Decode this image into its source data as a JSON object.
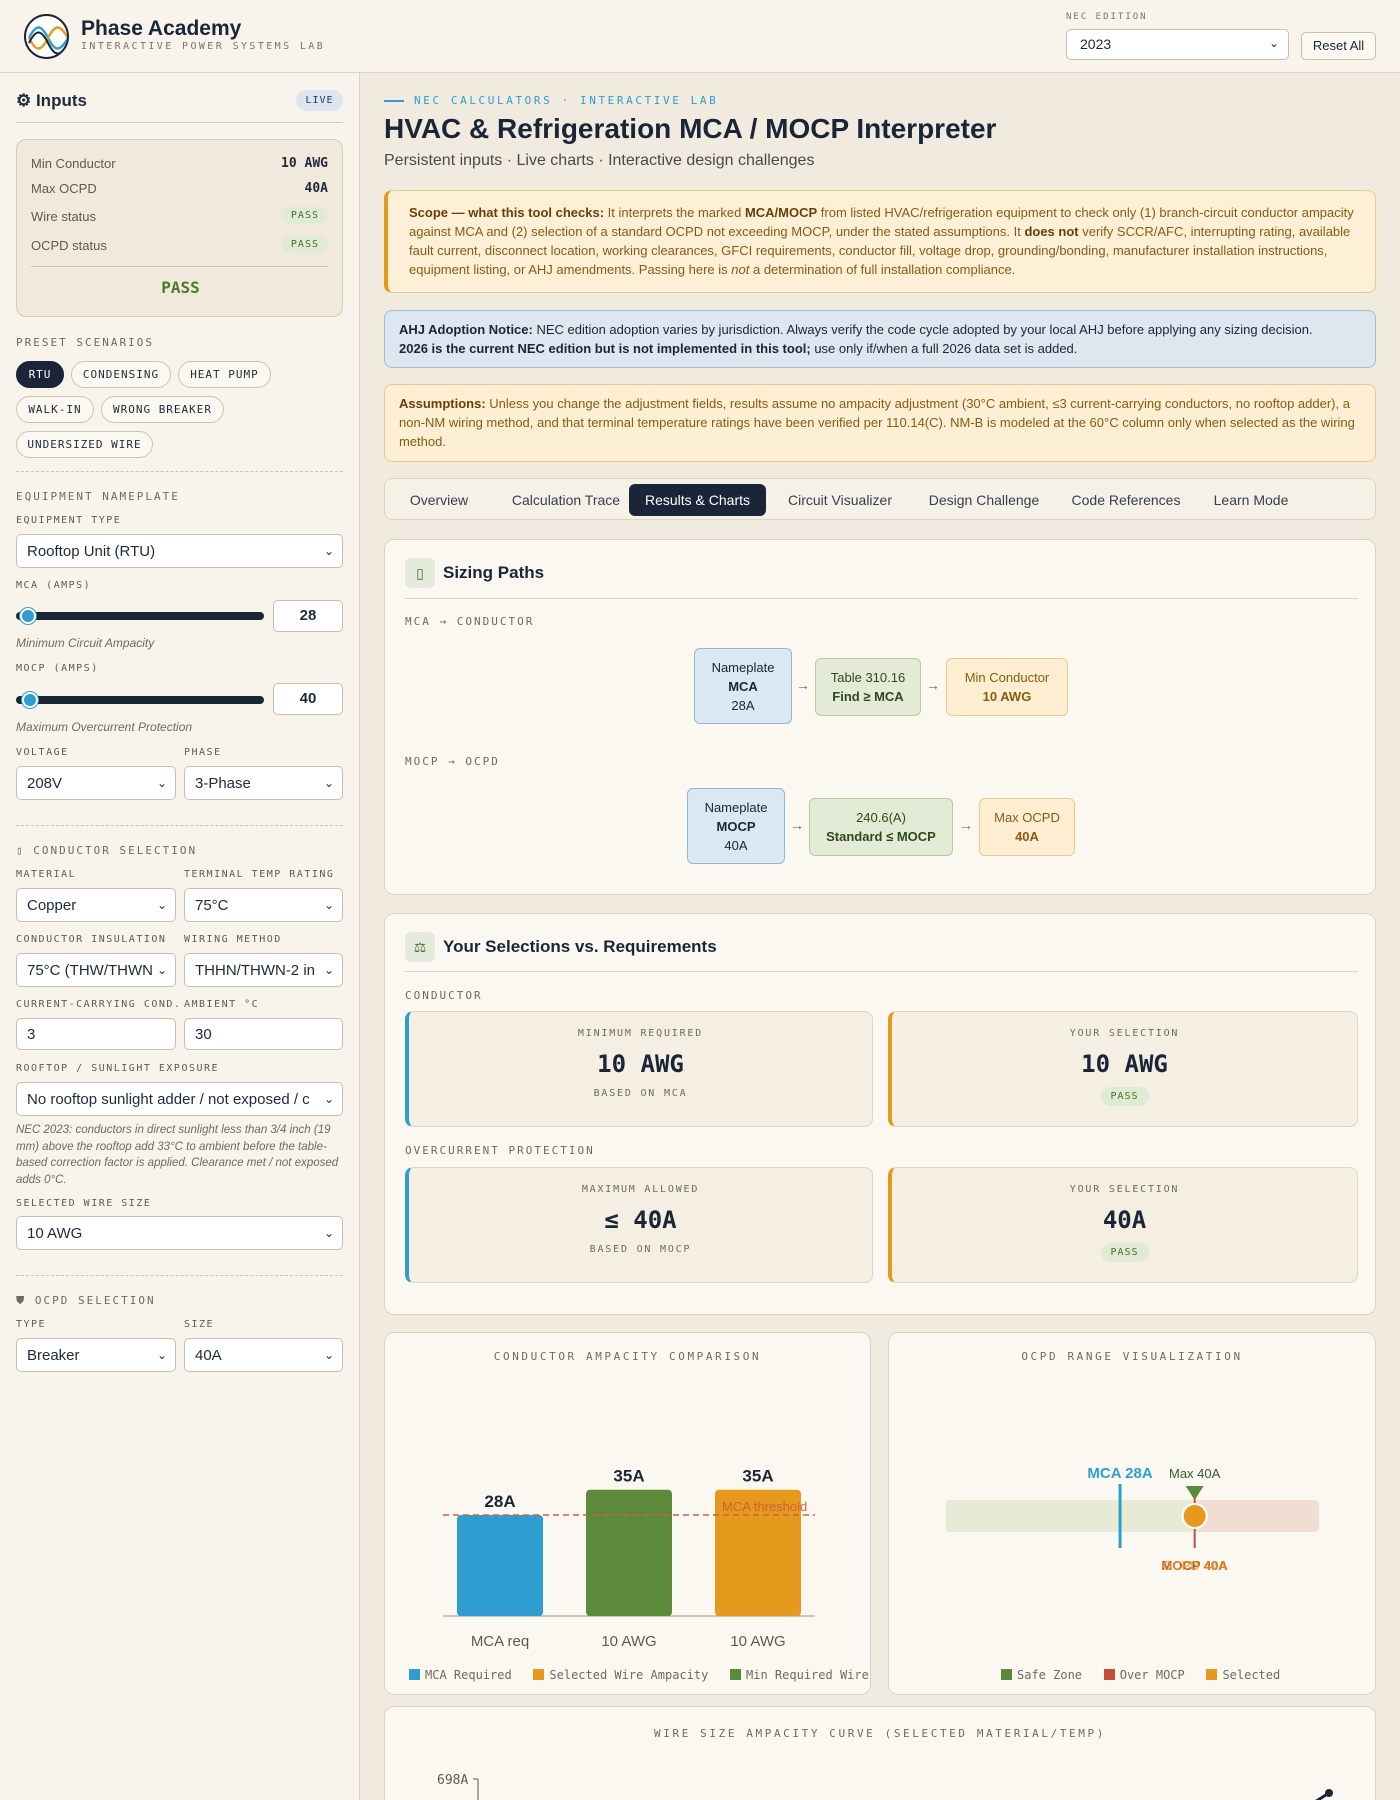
{
  "header": {
    "brand_name": "Phase Academy",
    "brand_sub": "INTERACTIVE POWER SYSTEMS LAB",
    "nec_label": "NEC EDITION",
    "nec_value": "2023",
    "reset_label": "Reset All"
  },
  "sidebar": {
    "title": "⚙ Inputs",
    "live": "LIVE",
    "summary": {
      "min_conductor_label": "Min Conductor",
      "min_conductor_value": "10 AWG",
      "max_ocpd_label": "Max OCPD",
      "max_ocpd_value": "40A",
      "wire_status_label": "Wire status",
      "wire_status_value": "PASS",
      "ocpd_status_label": "OCPD status",
      "ocpd_status_value": "PASS",
      "overall": "PASS"
    },
    "presets_label": "PRESET SCENARIOS",
    "presets": [
      "RTU",
      "CONDENSING",
      "HEAT PUMP",
      "WALK-IN",
      "WRONG BREAKER",
      "UNDERSIZED WIRE"
    ],
    "nameplate_label": "EQUIPMENT NAMEPLATE",
    "equipment_type_label": "EQUIPMENT TYPE",
    "equipment_type": "Rooftop Unit (RTU)",
    "mca_label": "MCA (AMPS)",
    "mca_value": "28",
    "mca_hint": "Minimum Circuit Ampacity",
    "mocp_label": "MOCP (AMPS)",
    "mocp_value": "40",
    "mocp_hint": "Maximum Overcurrent Protection",
    "voltage_label": "VOLTAGE",
    "voltage": "208V",
    "phase_label": "PHASE",
    "phase": "3-Phase",
    "conductor_label": "▯ CONDUCTOR SELECTION",
    "material_label": "MATERIAL",
    "material": "Copper",
    "terminal_label": "TERMINAL TEMP RATING",
    "terminal": "75°C",
    "insulation_label": "CONDUCTOR INSULATION",
    "insulation": "75°C (THW/THWN",
    "wiring_label": "WIRING METHOD",
    "wiring": "THHN/THWN-2 in",
    "ccc_label": "CURRENT-CARRYING COND.",
    "ccc": "3",
    "ambient_label": "AMBIENT °C",
    "ambient": "30",
    "rooftop_label": "ROOFTOP / SUNLIGHT EXPOSURE",
    "rooftop": "No rooftop sunlight adder / not exposed / c",
    "rooftop_hint": "NEC 2023: conductors in direct sunlight less than 3/4 inch (19 mm) above the rooftop add 33°C to ambient before the table-based correction factor is applied. Clearance met / not exposed adds 0°C.",
    "wire_size_label": "SELECTED WIRE SIZE",
    "wire_size": "10 AWG",
    "ocpd_label": "⛊ OCPD SELECTION",
    "ocpd_type_label": "TYPE",
    "ocpd_type": "Breaker",
    "ocpd_size_label": "SIZE",
    "ocpd_size": "40A"
  },
  "main": {
    "crumb": "NEC CALCULATORS · INTERACTIVE LAB",
    "title": "HVAC & Refrigeration MCA / MOCP Interpreter",
    "subtitle": "Persistent inputs · Live charts · Interactive design challenges",
    "scope": {
      "lead": "Scope — what this tool checks:",
      "t1": " It interprets the marked ",
      "b1": "MCA/MOCP",
      "t2": " from listed HVAC/refrigeration equipment to check only (1) branch-circuit conductor ampacity against MCA and (2) selection of a standard OCPD not exceeding MOCP, under the stated assumptions. It ",
      "b2": "does not",
      "t3": " verify SCCR/AFC, interrupting rating, available fault current, disconnect location, working clearances, GFCI requirements, conductor fill, voltage drop, grounding/bonding, manufacturer installation instructions, equipment listing, or AHJ amendments. Passing here is ",
      "i1": "not",
      "t4": " a determination of full installation compliance."
    },
    "ahj": {
      "lead": "AHJ Adoption Notice:",
      "t1": " NEC edition adoption varies by jurisdiction. Always verify the code cycle adopted by your local AHJ before applying any sizing decision.",
      "b1": "2026 is the current NEC edition but is not implemented in this tool;",
      "t2": " use only if/when a full 2026 data set is added."
    },
    "assume": {
      "lead": "Assumptions:",
      "t1": " Unless you change the adjustment fields, results assume no ampacity adjustment (30°C ambient, ≤3 current-carrying conductors, no rooftop adder), a non-NM wiring method, and that terminal temperature ratings have been verified per 110.14(C). NM-B is modeled at the 60°C column only when selected as the wiring method."
    },
    "tabs": [
      "Overview",
      "Calculation Trace",
      "Results & Charts",
      "Circuit Visualizer",
      "Design Challenge",
      "Code References",
      "Learn Mode"
    ],
    "sizing": {
      "icon": "▯",
      "title": "Sizing Paths",
      "mca_path_label": "MCA → CONDUCTOR",
      "mocp_path_label": "MOCP → OCPD",
      "mca_box1": [
        "Nameplate",
        "MCA",
        "28A"
      ],
      "mca_box2": [
        "Table 310.16",
        "Find ≥ MCA"
      ],
      "mca_box3": [
        "Min Conductor",
        "10 AWG"
      ],
      "mocp_box1": [
        "Nameplate",
        "MOCP",
        "40A"
      ],
      "mocp_box2": [
        "240.6(A)",
        "Standard ≤ MOCP"
      ],
      "mocp_box3": [
        "Max OCPD",
        "40A"
      ]
    },
    "selections": {
      "icon": "⚖",
      "title": "Your Selections vs. Requirements",
      "conductor_label": "CONDUCTOR",
      "ocp_label": "OVERCURRENT PROTECTION",
      "c_req": {
        "t1": "MINIMUM REQUIRED",
        "t2": "10 AWG",
        "t3": "BASED ON MCA"
      },
      "c_sel": {
        "t1": "YOUR SELECTION",
        "t2": "10 AWG",
        "pass": "PASS"
      },
      "o_req": {
        "t1": "MAXIMUM ALLOWED",
        "t2": "≤ 40A",
        "t3": "BASED ON MOCP"
      },
      "o_sel": {
        "t1": "YOUR SELECTION",
        "t2": "40A",
        "pass": "PASS"
      }
    },
    "curve_title": "WIRE SIZE AMPACITY CURVE (SELECTED MATERIAL/TEMP)"
  },
  "chart_data": [
    {
      "type": "bar",
      "title": "CONDUCTOR AMPACITY COMPARISON",
      "categories": [
        "MCA req",
        "10 AWG",
        "10 AWG"
      ],
      "values": [
        28,
        35,
        35
      ],
      "value_labels": [
        "28A",
        "35A",
        "35A"
      ],
      "colors": [
        "#2e9ed0",
        "#5a8a3a",
        "#e59a1e"
      ],
      "threshold": {
        "label": "MCA threshold",
        "value": 28
      },
      "ylim": [
        0,
        40
      ],
      "legend": [
        "MCA Required",
        "Selected Wire Ampacity",
        "Min Required Wire"
      ],
      "legend_colors": [
        "#2e9ed0",
        "#e59a1e",
        "#5a8a3a"
      ]
    },
    {
      "type": "range",
      "title": "OCPD RANGE VISUALIZATION",
      "mca": 28,
      "mca_label": "MCA 28A",
      "max": 40,
      "max_label": "Max 40A",
      "mocp_label": "MOCP 40A",
      "selected": 40,
      "selected_label": "OCPD 40A",
      "range": [
        0,
        60
      ],
      "legend": [
        "Safe Zone",
        "Over MOCP",
        "Selected"
      ],
      "legend_colors": [
        "#5a8a3a",
        "#c0503a",
        "#e59a1e"
      ]
    },
    {
      "type": "line",
      "title": "WIRE SIZE AMPACITY CURVE (SELECTED MATERIAL/TEMP)",
      "y_max_label": "698A"
    }
  ]
}
